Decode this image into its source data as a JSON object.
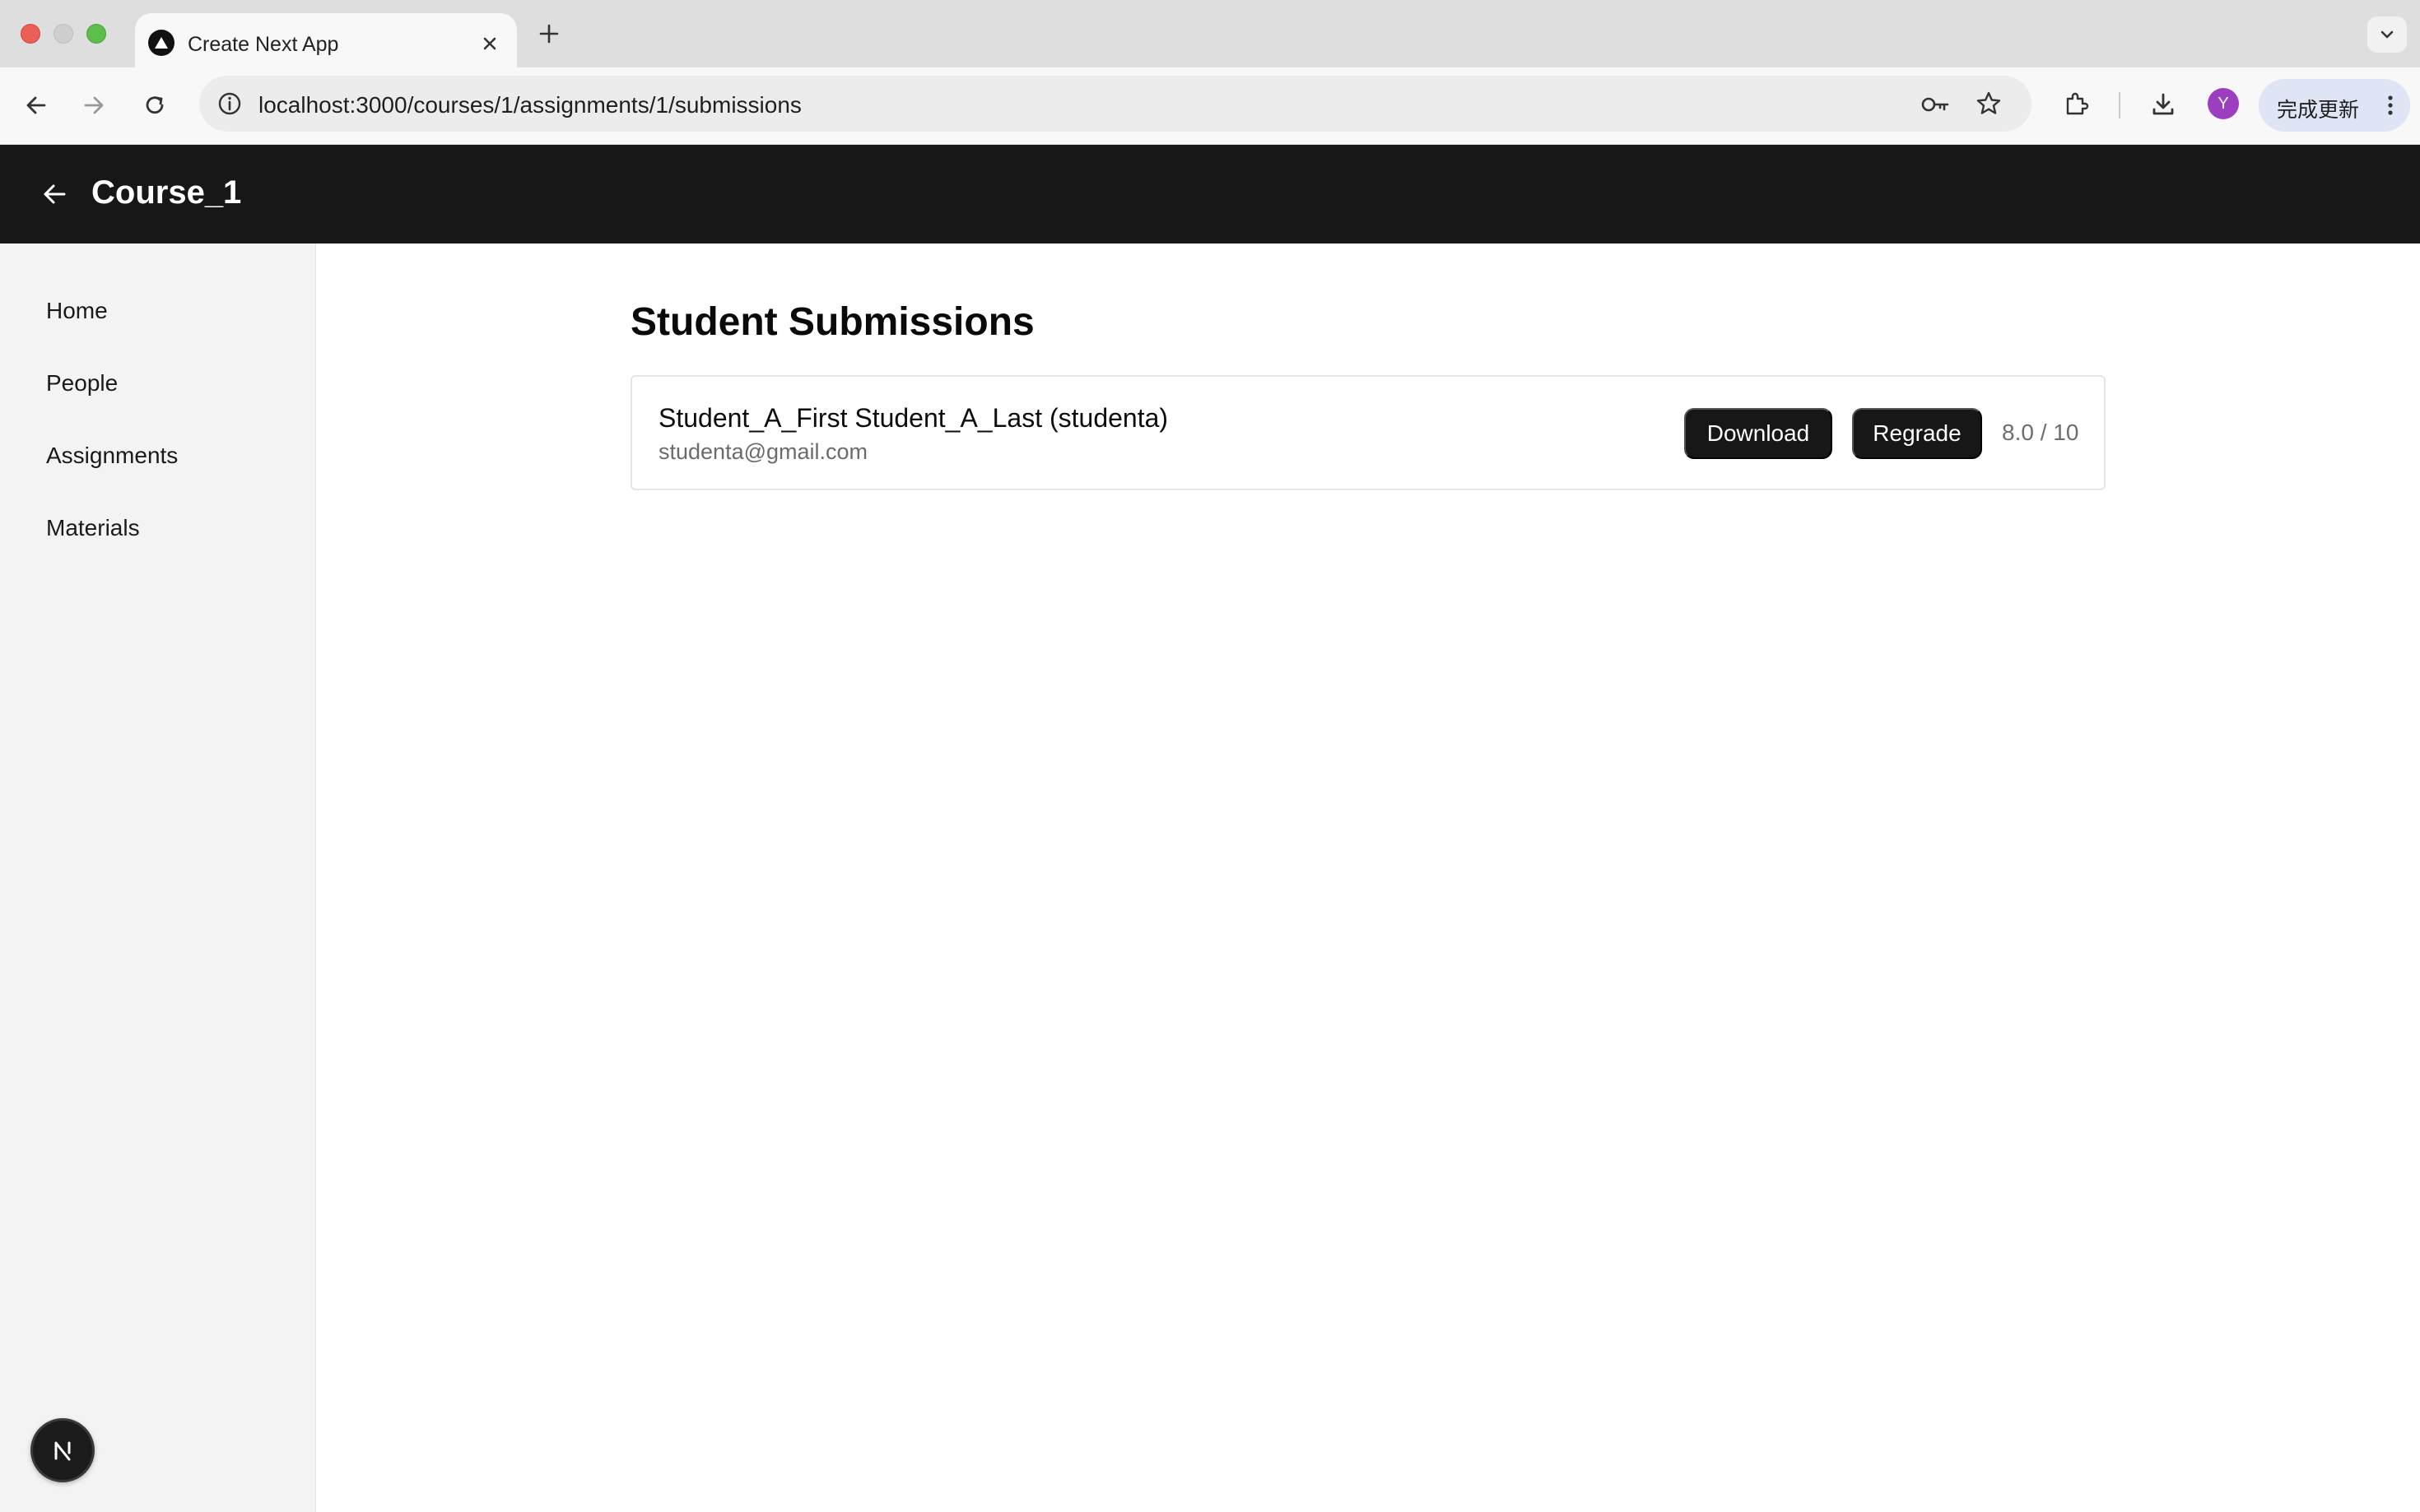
{
  "browser": {
    "tab": {
      "title": "Create Next App"
    },
    "address_bar": {
      "url": "localhost:3000/courses/1/assignments/1/submissions"
    },
    "profile": {
      "initial": "Y",
      "color": "#9b3fc0"
    },
    "update_button": {
      "label": "完成更新"
    },
    "icons": [
      "back-icon",
      "forward-icon",
      "reload-icon",
      "info-icon",
      "key-icon",
      "star-icon",
      "extensions-icon",
      "download-icon",
      "more-icon"
    ]
  },
  "app_header": {
    "course_title": "Course_1",
    "background": "#171717"
  },
  "sidebar": {
    "items": [
      {
        "label": "Home"
      },
      {
        "label": "People"
      },
      {
        "label": "Assignments"
      },
      {
        "label": "Materials"
      }
    ],
    "badge_letter": "N"
  },
  "main": {
    "page_title": "Student Submissions",
    "submissions": [
      {
        "student_name": "Student_A_First Student_A_Last (studenta)",
        "email": "studenta@gmail.com",
        "download_label": "Download",
        "regrade_label": "Regrade",
        "score": "8.0 / 10"
      }
    ]
  }
}
